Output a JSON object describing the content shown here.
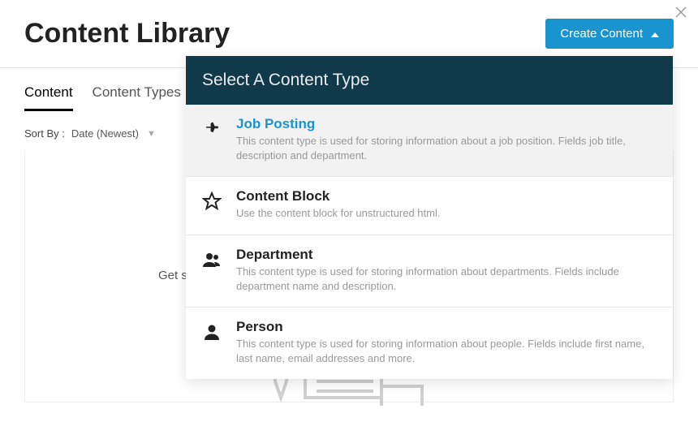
{
  "header": {
    "title": "Content Library",
    "create_label": "Create Content"
  },
  "tabs": [
    {
      "label": "Content",
      "active": true
    },
    {
      "label": "Content Types",
      "active": false
    }
  ],
  "sort": {
    "label": "Sort By :",
    "value": "Date (Newest)"
  },
  "body": {
    "get_started_prefix": "Get s"
  },
  "dropdown": {
    "header": "Select A Content Type",
    "items": [
      {
        "icon": "pin-icon",
        "title": "Job Posting",
        "desc": "This content type is used for storing information about a job position. Fields job title, description and department.",
        "highlight": true
      },
      {
        "icon": "star-outline-icon",
        "title": "Content Block",
        "desc": "Use the content block for unstructured html.",
        "highlight": false
      },
      {
        "icon": "people-icon",
        "title": "Department",
        "desc": "This content type is used for storing information about departments. Fields include department name and description.",
        "highlight": false
      },
      {
        "icon": "person-icon",
        "title": "Person",
        "desc": "This content type is used for storing information about people. Fields include first name, last name, email addresses and more.",
        "highlight": false
      }
    ]
  }
}
